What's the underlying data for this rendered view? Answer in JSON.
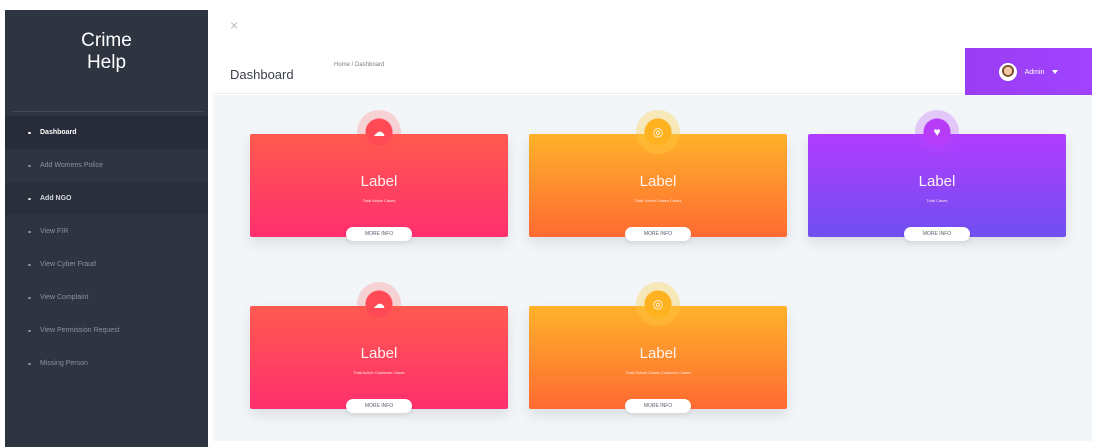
{
  "window": {
    "close_icon": "×"
  },
  "sidebar": {
    "brand_line_1": "Crime",
    "brand_line_2": "Help",
    "items": [
      {
        "label": "Dashboard",
        "state": "active"
      },
      {
        "label": "Add Womens Police",
        "state": "default"
      },
      {
        "label": "Add NGO",
        "state": "highlighted"
      },
      {
        "label": "View FIR",
        "state": "default"
      },
      {
        "label": "View Cyber Fraud",
        "state": "default"
      },
      {
        "label": "View Complaint",
        "state": "default"
      },
      {
        "label": "View Permission Request",
        "state": "default"
      },
      {
        "label": "Missing Person",
        "state": "default"
      }
    ]
  },
  "header": {
    "title": "Dashboard",
    "breadcrumb": "Home / Dashboard",
    "user": {
      "label": "Admin",
      "avatar_icon": "avatar-icon",
      "menu_icon": "chevron-down-icon"
    }
  },
  "cards": [
    {
      "label": "Label",
      "caption": "Total Active Cases",
      "button": "MORE INFO",
      "color": "red",
      "icon": "cloud-icon"
    },
    {
      "label": "Label",
      "caption": "Total Solved Cases Cases",
      "button": "MORE INFO",
      "color": "orange",
      "icon": "target-icon"
    },
    {
      "label": "Label",
      "caption": "Total Cases",
      "button": "MORE INFO",
      "color": "purple",
      "icon": "heart-icon"
    },
    {
      "label": "Label",
      "caption": "Total Active Customer Cases",
      "button": "MORE INFO",
      "color": "red",
      "icon": "cloud-icon"
    },
    {
      "label": "Label",
      "caption": "Total Solved Cases Customer Cases",
      "button": "MORE INFO",
      "color": "orange",
      "icon": "target-icon"
    }
  ],
  "colors": {
    "sidebar": "#2f3441",
    "accent_purple": "#9a3df3",
    "red": "#ff3f63",
    "orange": "#ff9a2b",
    "purple": "#8d48f6"
  }
}
